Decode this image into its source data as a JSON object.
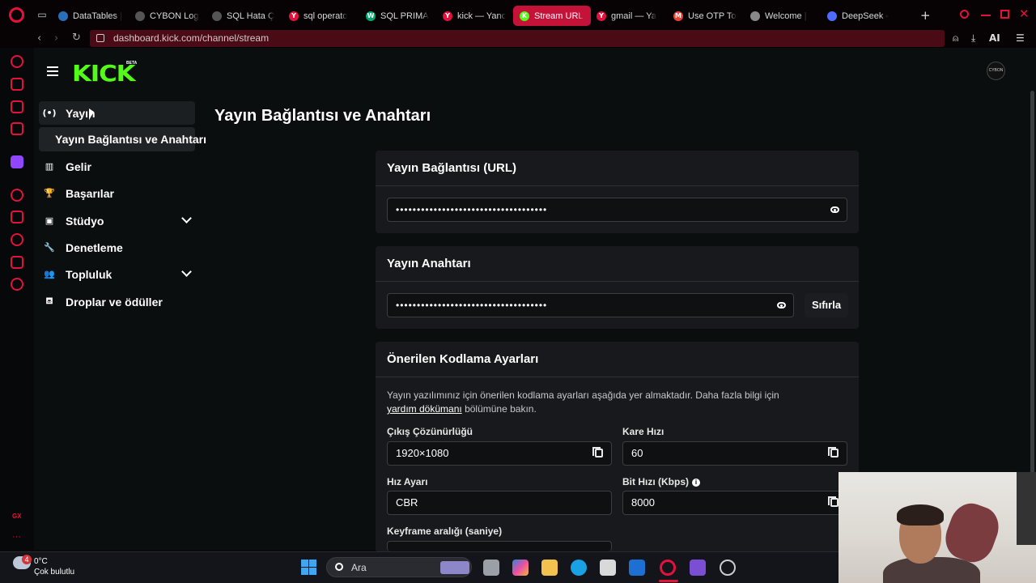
{
  "browser": {
    "tabs": [
      {
        "title": "DataTables |",
        "icon": "datatables-favicon",
        "color": "#2a6ebb",
        "glyph": ""
      },
      {
        "title": "CYBON Log",
        "icon": "openai-favicon",
        "color": "#555555",
        "glyph": ""
      },
      {
        "title": "SQL Hata Ç",
        "icon": "openai-favicon",
        "color": "#555555",
        "glyph": ""
      },
      {
        "title": "sql operato",
        "icon": "yandex-favicon",
        "color": "#e2123d",
        "glyph": "Y"
      },
      {
        "title": "SQL PRIMA",
        "icon": "w3schools-favicon",
        "color": "#04aa6d",
        "glyph": "W"
      },
      {
        "title": "kick — Yanc",
        "icon": "yandex-favicon",
        "color": "#e2123d",
        "glyph": "Y"
      },
      {
        "title": "Stream URL & Key - K",
        "icon": "kick-favicon",
        "color": "#53fc18",
        "glyph": "K"
      },
      {
        "title": "gmail — Ya",
        "icon": "yandex-favicon",
        "color": "#e2123d",
        "glyph": "Y"
      },
      {
        "title": "Use OTP To",
        "icon": "gmail-favicon",
        "color": "#ea4335",
        "glyph": "M"
      },
      {
        "title": "Welcome |",
        "icon": "document-favicon",
        "color": "#888888",
        "glyph": ""
      },
      {
        "title": "DeepSeek -",
        "icon": "deepseek-favicon",
        "color": "#4d6bfe",
        "glyph": ""
      }
    ],
    "active_tab": 6,
    "url": "dashboard.kick.com/channel/stream",
    "ai_label": "AI",
    "accent": "#e2123d"
  },
  "kick": {
    "logo": "KICK",
    "beta": "BETA",
    "avatar_text": "CYBON",
    "brand_color": "#53fc18",
    "nav": {
      "stream": "Yayın",
      "stream_sub": "Yayın Bağlantısı ve Anahtarı",
      "income": "Gelir",
      "achievements": "Başarılar",
      "studio": "Stüdyo",
      "moderation": "Denetleme",
      "community": "Topluluk",
      "drops": "Droplar ve ödüller"
    },
    "page_title": "Yayın Bağlantısı ve Anahtarı",
    "url_card": {
      "title": "Yayın Bağlantısı (URL)",
      "value": "••••••••••••••••••••••••••••••••••••"
    },
    "key_card": {
      "title": "Yayın Anahtarı",
      "value": "••••••••••••••••••••••••••••••••••••",
      "reset": "Sıfırla"
    },
    "encoding": {
      "title": "Önerilen Kodlama Ayarları",
      "desc_before": "Yayın yazılımınız için önerilen kodlama ayarları aşağıda yer almaktadır. Daha fazla bilgi için",
      "desc_link": "yardım dökümanı",
      "desc_after": "bölümüne bakın.",
      "resolution_label": "Çıkış Çözünürlüğü",
      "resolution": "1920×1080",
      "fps_label": "Kare Hızı",
      "fps": "60",
      "rate_label": "Hız Ayarı",
      "rate": "CBR",
      "bitrate_label": "Bit Hızı (Kbps)",
      "bitrate": "8000",
      "keyframe_label": "Keyframe aralığı (saniye)"
    }
  },
  "taskbar": {
    "temp": "0°C",
    "weather": "Çok bulutlu",
    "weather_badge": "4",
    "search": "Ara"
  }
}
